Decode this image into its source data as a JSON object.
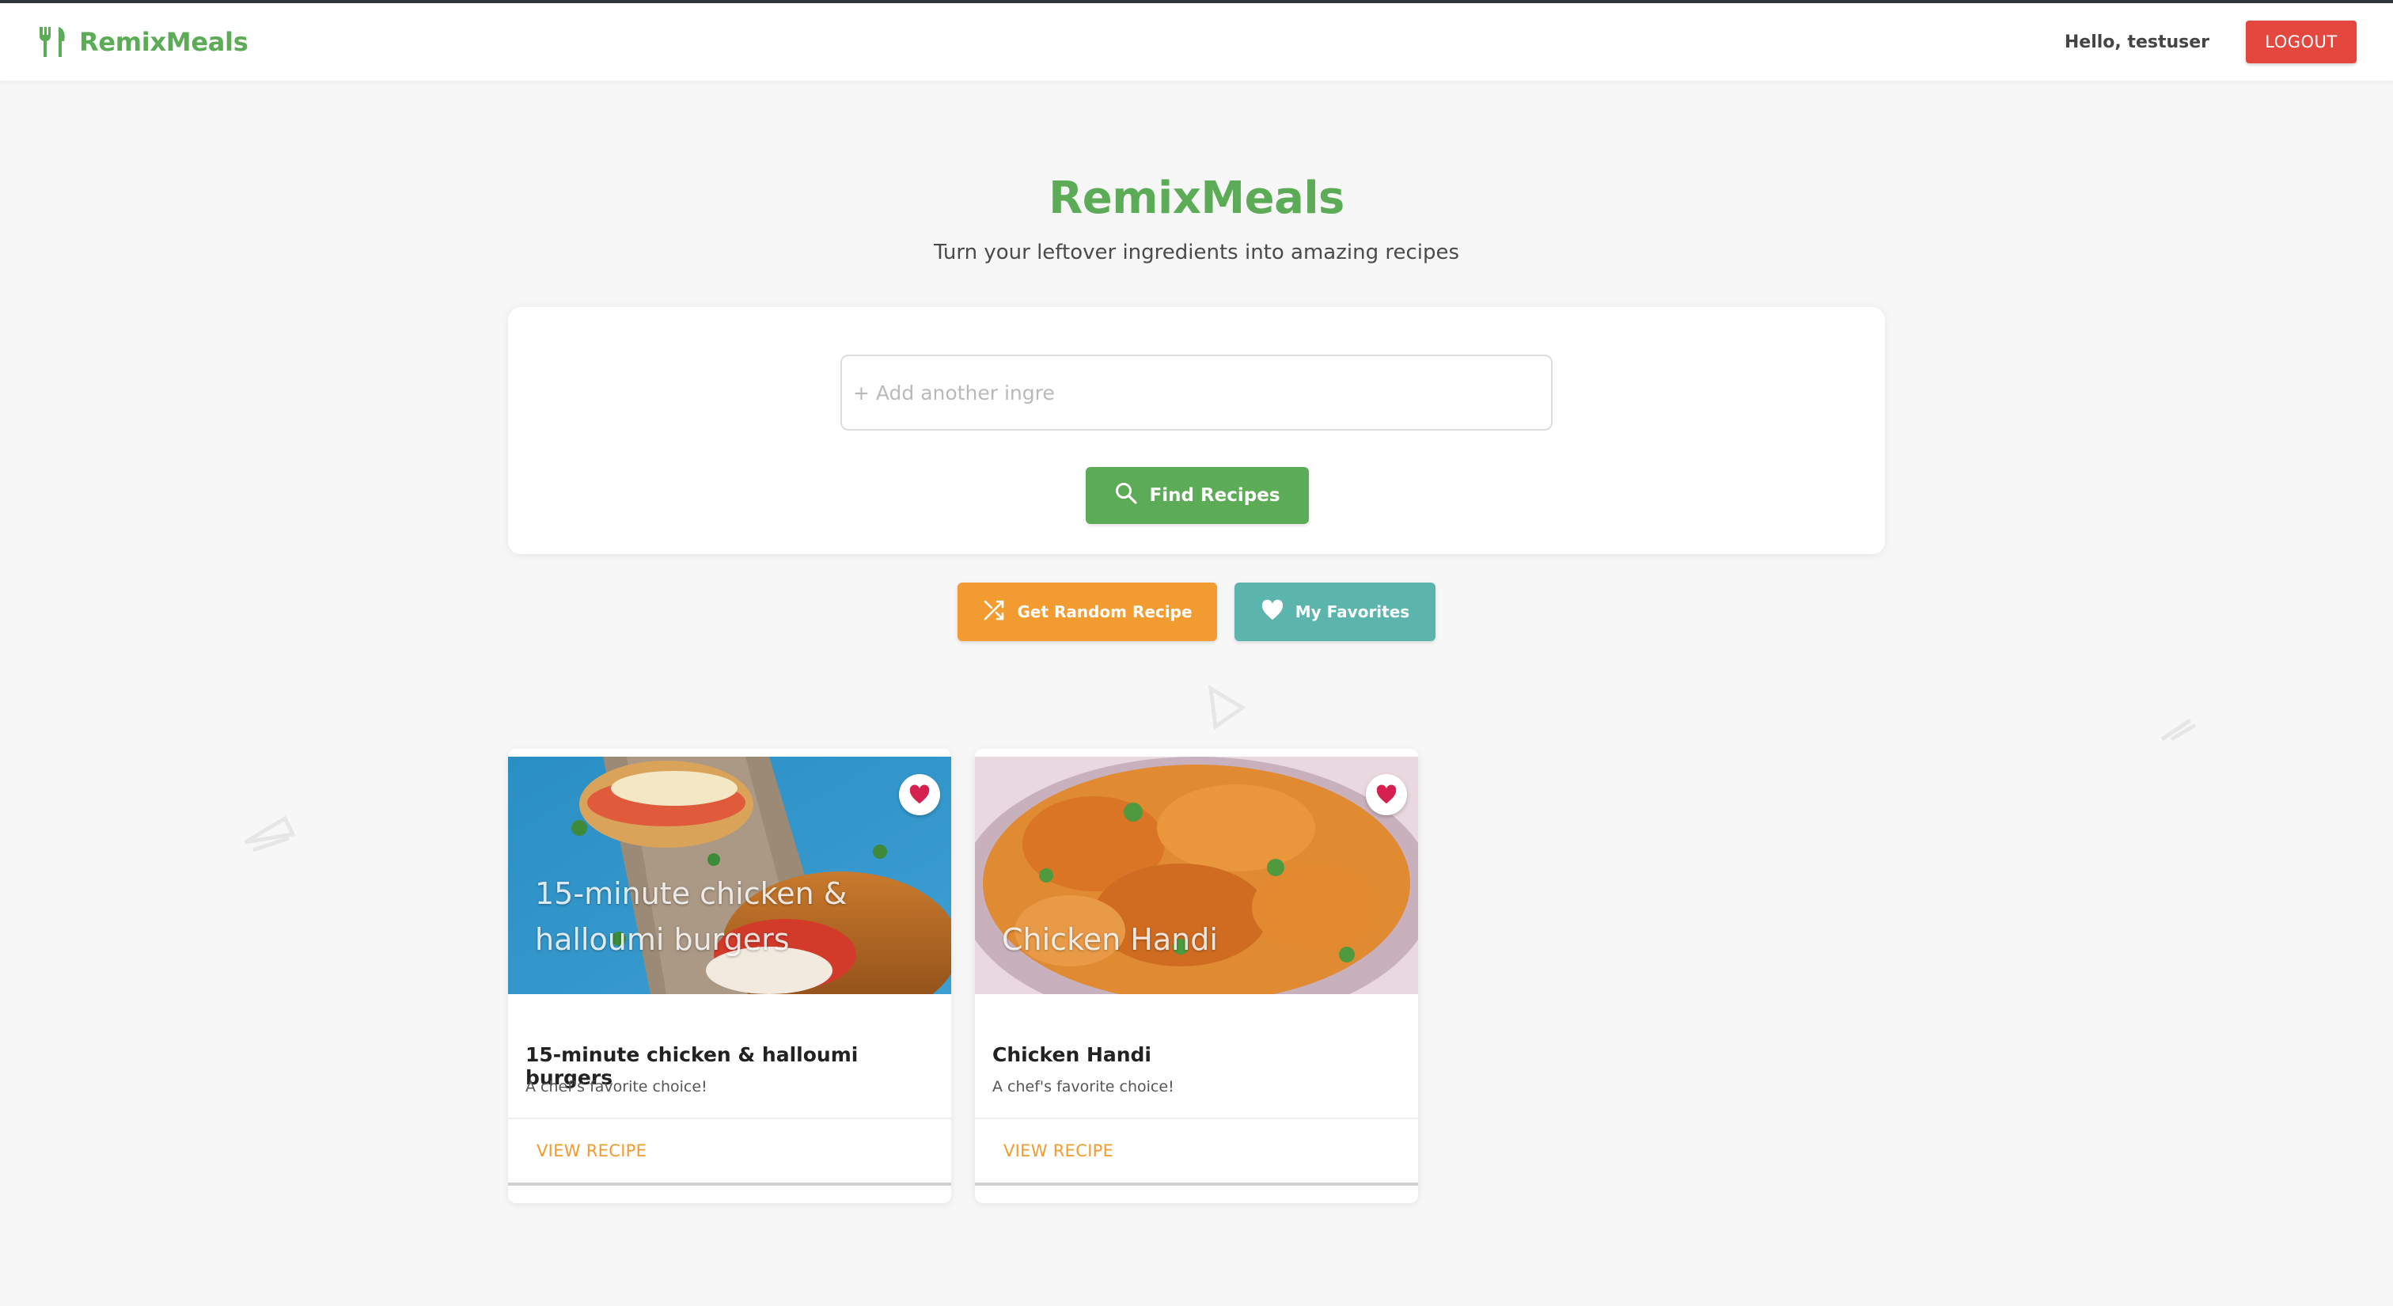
{
  "header": {
    "brand": "RemixMeals",
    "greeting": "Hello, testuser",
    "logout_label": "LOGOUT",
    "brand_icon": "fork-knife-icon"
  },
  "hero": {
    "title": "RemixMeals",
    "subtitle": "Turn your leftover ingredients into amazing recipes"
  },
  "search": {
    "placeholder": "+ Add another ingre",
    "value": "",
    "find_label": "Find Recipes",
    "find_icon": "search-icon"
  },
  "actions": {
    "random_label": "Get Random Recipe",
    "random_icon": "shuffle-icon",
    "favorites_label": "My Favorites",
    "favorites_icon": "heart-icon"
  },
  "recipes": [
    {
      "overlay_title": "15-minute chicken & halloumi burgers",
      "title": "15-minute chicken & halloumi burgers",
      "description": "A chef's favorite choice!",
      "action": "VIEW RECIPE",
      "favorited": true
    },
    {
      "overlay_title": "Chicken Handi",
      "title": "Chicken Handi",
      "description": "A chef's favorite choice!",
      "action": "VIEW RECIPE",
      "favorited": true
    }
  ],
  "colors": {
    "brand_green": "#5cab56",
    "logout_red": "#e4473e",
    "random_orange": "#f29b30",
    "favorites_teal": "#5bb5ad",
    "heart_red": "#d6204f"
  }
}
